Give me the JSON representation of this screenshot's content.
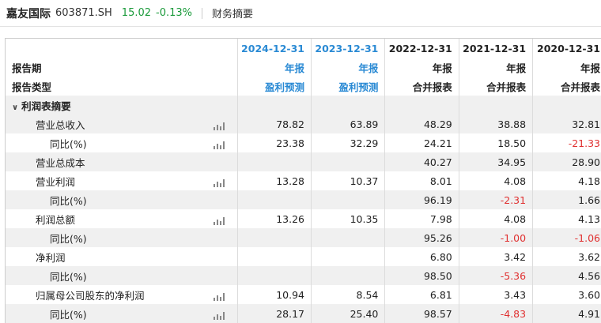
{
  "header": {
    "name": "嘉友国际",
    "code": "603871.SH",
    "price": "15.02",
    "change": "-0.13%",
    "tab": "财务摘要"
  },
  "columns": [
    {
      "date": "2024-12-31",
      "type": "年报",
      "sub": "盈利预测",
      "blue": true
    },
    {
      "date": "2023-12-31",
      "type": "年报",
      "sub": "盈利预测",
      "blue": true
    },
    {
      "date": "2022-12-31",
      "type": "年报",
      "sub": "合并报表",
      "blue": false
    },
    {
      "date": "2021-12-31",
      "type": "年报",
      "sub": "合并报表",
      "blue": false
    },
    {
      "date": "2020-12-31",
      "type": "年报",
      "sub": "合并报表",
      "blue": false
    }
  ],
  "labels": {
    "period": "报告期",
    "report_type": "报告类型",
    "section": "利润表摘要"
  },
  "rows": [
    {
      "label": "营业总收入",
      "level": 1,
      "bars": true,
      "values": [
        "78.82",
        "63.89",
        "48.29",
        "38.88",
        "32.81"
      ]
    },
    {
      "label": "同比(%)",
      "level": 2,
      "bars": true,
      "values": [
        "23.38",
        "32.29",
        "24.21",
        "18.50",
        "-21.33"
      ]
    },
    {
      "label": "营业总成本",
      "level": 1,
      "bars": false,
      "values": [
        "",
        "",
        "40.27",
        "34.95",
        "28.90"
      ]
    },
    {
      "label": "营业利润",
      "level": 1,
      "bars": true,
      "values": [
        "13.28",
        "10.37",
        "8.01",
        "4.08",
        "4.18"
      ]
    },
    {
      "label": "同比(%)",
      "level": 2,
      "bars": false,
      "values": [
        "",
        "",
        "96.19",
        "-2.31",
        "1.66"
      ]
    },
    {
      "label": "利润总额",
      "level": 1,
      "bars": true,
      "values": [
        "13.26",
        "10.35",
        "7.98",
        "4.08",
        "4.13"
      ]
    },
    {
      "label": "同比(%)",
      "level": 2,
      "bars": false,
      "values": [
        "",
        "",
        "95.26",
        "-1.00",
        "-1.06"
      ]
    },
    {
      "label": "净利润",
      "level": 1,
      "bars": false,
      "values": [
        "",
        "",
        "6.80",
        "3.42",
        "3.62"
      ]
    },
    {
      "label": "同比(%)",
      "level": 2,
      "bars": false,
      "values": [
        "",
        "",
        "98.50",
        "-5.36",
        "4.56"
      ]
    },
    {
      "label": "归属母公司股东的净利润",
      "level": 1,
      "bars": true,
      "values": [
        "10.94",
        "8.54",
        "6.81",
        "3.43",
        "3.60"
      ]
    },
    {
      "label": "同比(%)",
      "level": 2,
      "bars": true,
      "values": [
        "28.17",
        "25.40",
        "98.57",
        "-4.83",
        "4.91"
      ]
    }
  ]
}
